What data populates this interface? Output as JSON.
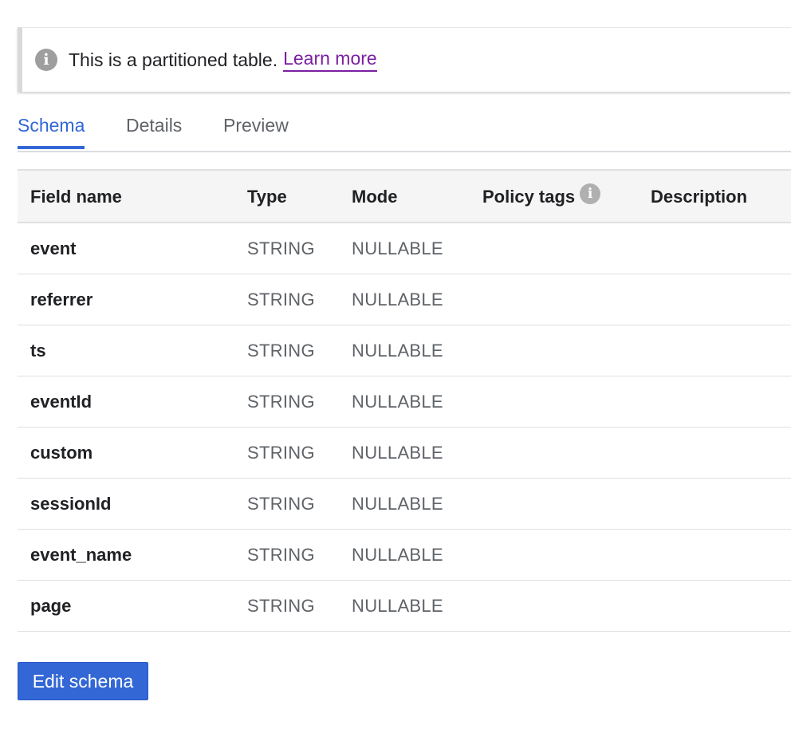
{
  "banner": {
    "icon": "info-icon",
    "text": "This is a partitioned table.",
    "link_label": "Learn more",
    "link_color": "#7b1fa2"
  },
  "tabs": [
    {
      "label": "Schema",
      "active": true
    },
    {
      "label": "Details",
      "active": false
    },
    {
      "label": "Preview",
      "active": false
    }
  ],
  "table": {
    "headers": {
      "field_name": "Field name",
      "type": "Type",
      "mode": "Mode",
      "policy_tags": "Policy tags",
      "policy_tags_icon": "info-icon",
      "description": "Description"
    },
    "rows": [
      {
        "field_name": "event",
        "type": "STRING",
        "mode": "NULLABLE",
        "policy_tags": "",
        "description": ""
      },
      {
        "field_name": "referrer",
        "type": "STRING",
        "mode": "NULLABLE",
        "policy_tags": "",
        "description": ""
      },
      {
        "field_name": "ts",
        "type": "STRING",
        "mode": "NULLABLE",
        "policy_tags": "",
        "description": ""
      },
      {
        "field_name": "eventId",
        "type": "STRING",
        "mode": "NULLABLE",
        "policy_tags": "",
        "description": ""
      },
      {
        "field_name": "custom",
        "type": "STRING",
        "mode": "NULLABLE",
        "policy_tags": "",
        "description": ""
      },
      {
        "field_name": "sessionId",
        "type": "STRING",
        "mode": "NULLABLE",
        "policy_tags": "",
        "description": ""
      },
      {
        "field_name": "event_name",
        "type": "STRING",
        "mode": "NULLABLE",
        "policy_tags": "",
        "description": ""
      },
      {
        "field_name": "page",
        "type": "STRING",
        "mode": "NULLABLE",
        "policy_tags": "",
        "description": ""
      }
    ]
  },
  "actions": {
    "edit_schema_label": "Edit schema"
  },
  "colors": {
    "accent": "#3367d6",
    "header_bg": "#f5f5f5",
    "muted_text": "#5f6368"
  }
}
